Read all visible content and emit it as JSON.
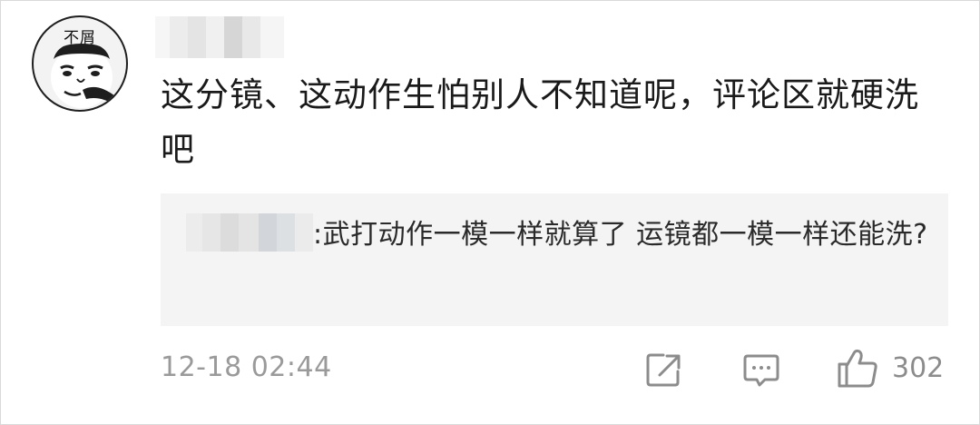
{
  "avatar": {
    "caption": "不屑",
    "icon": "meme-face-avatar"
  },
  "comment": {
    "username": "",
    "text": "这分镜、这动作生怕别人不知道呢，评论区就硬洗吧"
  },
  "reply": {
    "username": "",
    "separator": ":",
    "text": "武打动作一模一样就算了 运镜都一模一样还能洗?"
  },
  "footer": {
    "timestamp": "12-18 02:44",
    "share_icon": "share-icon",
    "comment_icon": "comment-icon",
    "like_icon": "thumbs-up-icon",
    "like_count": "302"
  },
  "colors": {
    "text_primary": "#1a1a1a",
    "text_secondary": "#9a9a9a",
    "reply_bg": "#f4f4f4",
    "icon_gray": "#8c8c8c"
  }
}
